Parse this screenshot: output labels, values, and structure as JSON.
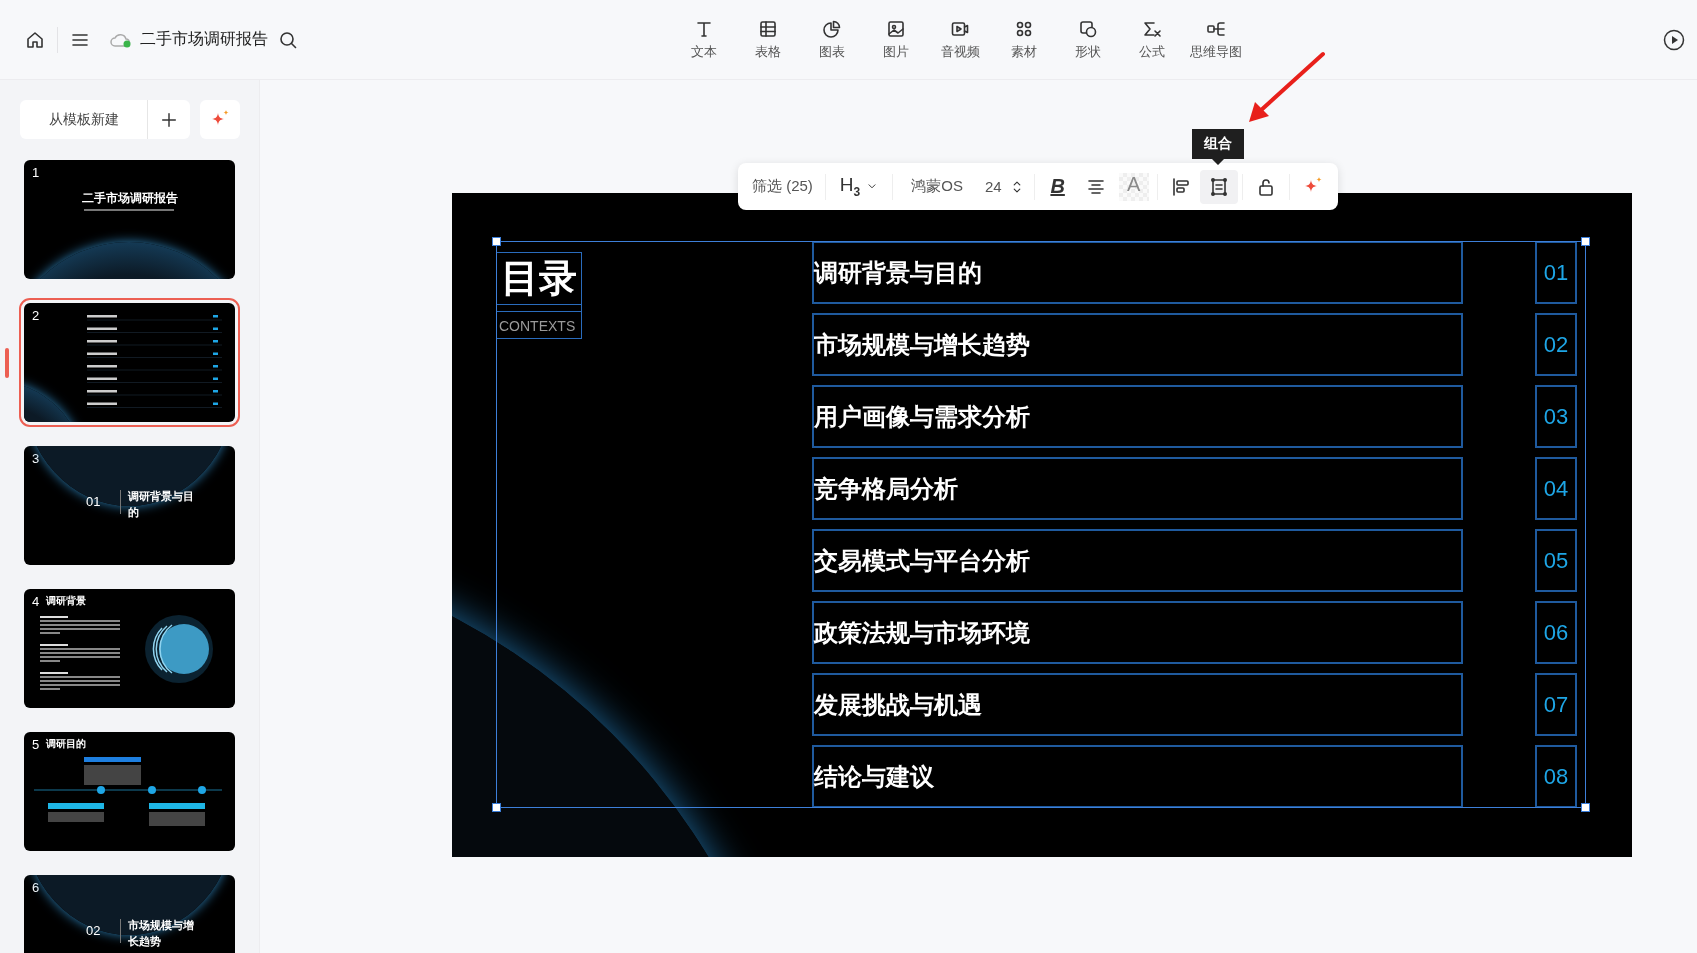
{
  "topbar": {
    "doc_title": "二手市场调研报告",
    "tools": [
      {
        "kind": "text",
        "label": "文本"
      },
      {
        "kind": "table",
        "label": "表格"
      },
      {
        "kind": "chart",
        "label": "图表"
      },
      {
        "kind": "image",
        "label": "图片"
      },
      {
        "kind": "video",
        "label": "音视频"
      },
      {
        "kind": "assets",
        "label": "素材"
      },
      {
        "kind": "shape",
        "label": "形状"
      },
      {
        "kind": "formula",
        "label": "公式"
      },
      {
        "kind": "mindmap",
        "label": "思维导图"
      }
    ]
  },
  "sidebar": {
    "template_button": "从模板新建",
    "slides": [
      {
        "number": "1",
        "kind": "title",
        "title": "二手市场调研报告",
        "selected": false
      },
      {
        "number": "2",
        "kind": "contents",
        "selected": true
      },
      {
        "number": "3",
        "kind": "section",
        "index": "01",
        "title": "调研背景与目的",
        "selected": false
      },
      {
        "number": "4",
        "kind": "text",
        "title": "调研背景",
        "selected": false
      },
      {
        "number": "5",
        "kind": "timeline",
        "title": "调研目的",
        "selected": false
      },
      {
        "number": "6",
        "kind": "section",
        "index": "02",
        "title": "市场规模与增长趋势",
        "selected": false
      }
    ]
  },
  "toolbar": {
    "filter": "筛选 (25)",
    "heading": "H$_{3}$",
    "font": "鸿蒙OS",
    "size": "24",
    "tooltip": "组合",
    "buttons": [
      {
        "kind": "bold",
        "label": "B",
        "hovered": false
      },
      {
        "kind": "align_center",
        "hovered": false
      },
      {
        "kind": "text_fill",
        "label": "A",
        "hovered": false
      },
      {
        "kind": "align_left",
        "hovered": false
      },
      {
        "kind": "group",
        "hovered": true
      },
      {
        "kind": "lock",
        "hovered": false
      },
      {
        "kind": "ai",
        "hovered": false
      }
    ]
  },
  "slide": {
    "title": "目录",
    "subtitle": "CONTEXTS",
    "items": [
      {
        "label": "调研背景与目的",
        "number": "01"
      },
      {
        "label": "市场规模与增长趋势",
        "number": "02"
      },
      {
        "label": "用户画像与需求分析",
        "number": "03"
      },
      {
        "label": "竞争格局分析",
        "number": "04"
      },
      {
        "label": "交易模式与平台分析",
        "number": "05"
      },
      {
        "label": "政策法规与市场环境",
        "number": "06"
      },
      {
        "label": "发展挑战与机遇",
        "number": "07"
      },
      {
        "label": "结论与建议",
        "number": "08"
      }
    ]
  }
}
